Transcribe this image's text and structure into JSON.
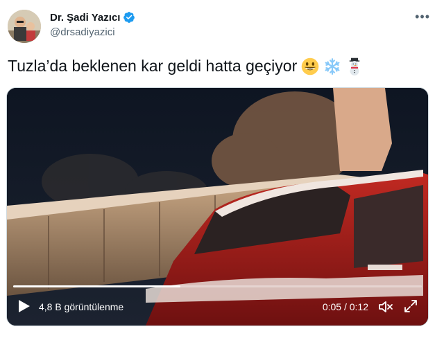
{
  "author": {
    "name": "Dr. Şadi Yazıcı",
    "handle": "@drsadiyazici",
    "verified_icon": "verified-badge-icon"
  },
  "menu": {
    "more_label": "•••"
  },
  "tweet": {
    "text": "Tuzla’da beklenen kar geldi hatta geçiyor",
    "emojis": [
      "grinning-face-emoji",
      "snowflake-emoji",
      "snowman-emoji"
    ]
  },
  "video": {
    "views": "4,8 B görüntülenme",
    "time": "0:05 / 0:12",
    "progress": 0.41,
    "icons": [
      "play-icon",
      "mute-icon",
      "fullscreen-icon"
    ]
  },
  "colors": {
    "text": "#0f1419",
    "secondary": "#536471",
    "verified": "#1d9bf0",
    "car_red": "#b3201e"
  }
}
